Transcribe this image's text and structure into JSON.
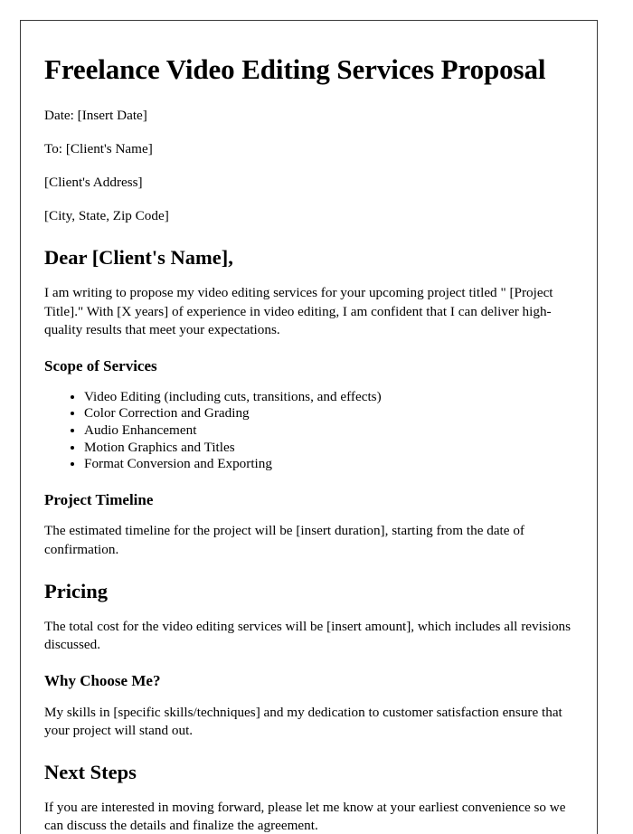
{
  "document": {
    "title": "Freelance Video Editing Services Proposal",
    "meta": {
      "date_line": "Date: [Insert Date]",
      "to_line": "To: [Client's Name]",
      "address_line": "[Client's Address]",
      "city_state_zip_line": "[City, State, Zip Code]"
    },
    "salutation": "Dear [Client's Name],",
    "intro_paragraph": "I am writing to propose my video editing services for your upcoming project titled \" [Project Title].\" With [X years] of experience in video editing, I am confident that I can deliver high-quality results that meet your expectations.",
    "sections": {
      "scope": {
        "heading": "Scope of Services",
        "items": [
          "Video Editing (including cuts, transitions, and effects)",
          "Color Correction and Grading",
          "Audio Enhancement",
          "Motion Graphics and Titles",
          "Format Conversion and Exporting"
        ]
      },
      "timeline": {
        "heading": "Project Timeline",
        "body": "The estimated timeline for the project will be [insert duration], starting from the date of confirmation."
      },
      "pricing": {
        "heading": "Pricing",
        "body": "The total cost for the video editing services will be [insert amount], which includes all revisions discussed."
      },
      "why_choose_me": {
        "heading": "Why Choose Me?",
        "body": "My skills in [specific skills/techniques] and my dedication to customer satisfaction ensure that your project will stand out."
      },
      "next_steps": {
        "heading": "Next Steps",
        "body": "If you are interested in moving forward, please let me know at your earliest convenience so we can discuss the details and finalize the agreement."
      }
    }
  }
}
